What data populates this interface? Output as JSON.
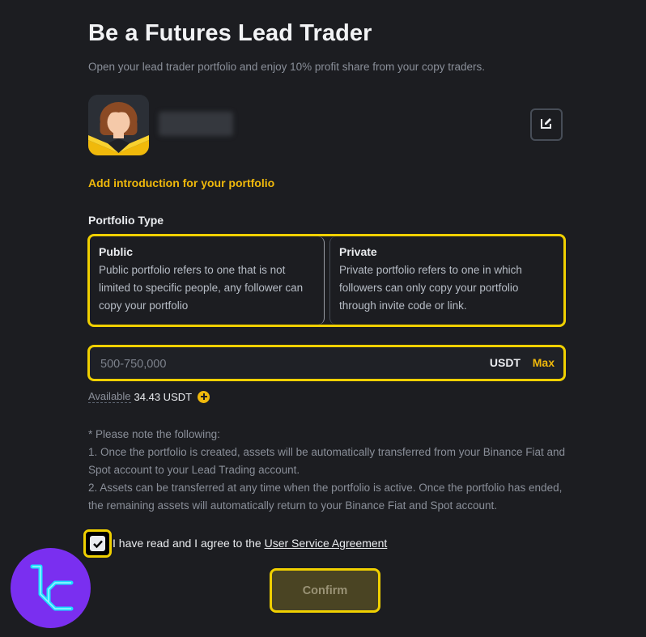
{
  "header": {
    "title": "Be a Futures Lead Trader",
    "subtitle": "Open your lead trader portfolio and enjoy 10% profit share from your copy traders."
  },
  "profile": {
    "add_intro_label": "Add introduction for your portfolio"
  },
  "portfolio_type": {
    "label": "Portfolio Type",
    "options": [
      {
        "title": "Public",
        "description": "Public portfolio refers to one that is not limited to specific people, any follower can copy your portfolio"
      },
      {
        "title": "Private",
        "description": "Private portfolio refers to one in which followers can only copy your portfolio through invite code or link."
      }
    ]
  },
  "amount": {
    "placeholder": "500-750,000",
    "value": "",
    "currency": "USDT",
    "max_label": "Max"
  },
  "available": {
    "label": "Available",
    "value": "34.43 USDT"
  },
  "notes": [
    "* Please note the following:",
    "1. Once the portfolio is created, assets will be automatically transferred from your Binance Fiat and Spot account to your Lead Trading account.",
    "2. Assets can be transferred at any time when the portfolio is active. Once the portfolio has ended, the remaining assets will automatically return to your Binance Fiat and Spot account."
  ],
  "agreement": {
    "checked": true,
    "text": "I have read and I agree to the",
    "link_text": "User Service Agreement"
  },
  "confirm_label": "Confirm",
  "colors": {
    "accent": "#f0b90b",
    "highlight": "#f0d000",
    "background": "#1c1d21",
    "logo": "#7a2ff0"
  },
  "icons": [
    "edit-icon",
    "plus-circle-icon",
    "checkmark-icon",
    "logo-icon"
  ]
}
